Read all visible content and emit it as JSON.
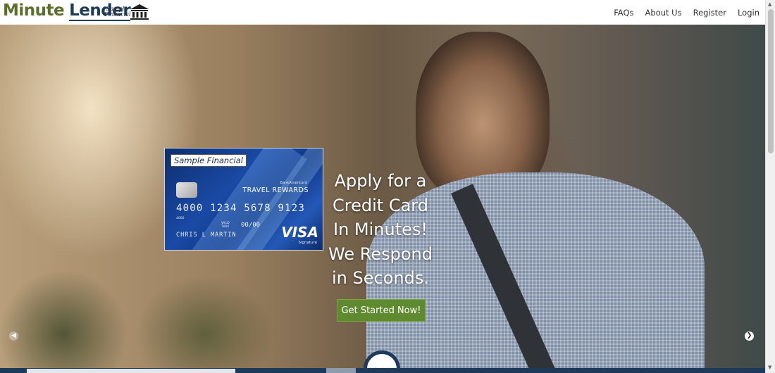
{
  "header": {
    "logo_word1": "Minute",
    "logo_word2": "Lender",
    "partner_logo_text": "Sample Financial",
    "nav": [
      "FAQs",
      "About Us",
      "Register",
      "Login"
    ]
  },
  "hero": {
    "card": {
      "issuer": "Sample Financial",
      "small_brand": "BankAmericard",
      "product": "TRAVEL REWARDS",
      "number": "4000 1234 5678 9123",
      "number_small": "4000",
      "valid_label": "VALID THRU",
      "expiry": "00/00",
      "holder": "CHRIS L MARTIN",
      "network": "VISA",
      "network_sub": "Signature"
    },
    "headline": [
      "Apply for a",
      "Credit Card",
      "In Minutes!",
      "We Respond",
      "in Seconds."
    ],
    "cta_label": "Get Started Now!",
    "prev_icon": "chevron-left-icon",
    "next_icon": "chevron-right-icon",
    "scroll_icon": "chevron-down-icon"
  },
  "colors": {
    "logo_green": "#5a6f2a",
    "logo_navy": "#1f3b5a",
    "cta_green": "#5f8a2f",
    "bottom_bar": "#1e3a5a"
  }
}
